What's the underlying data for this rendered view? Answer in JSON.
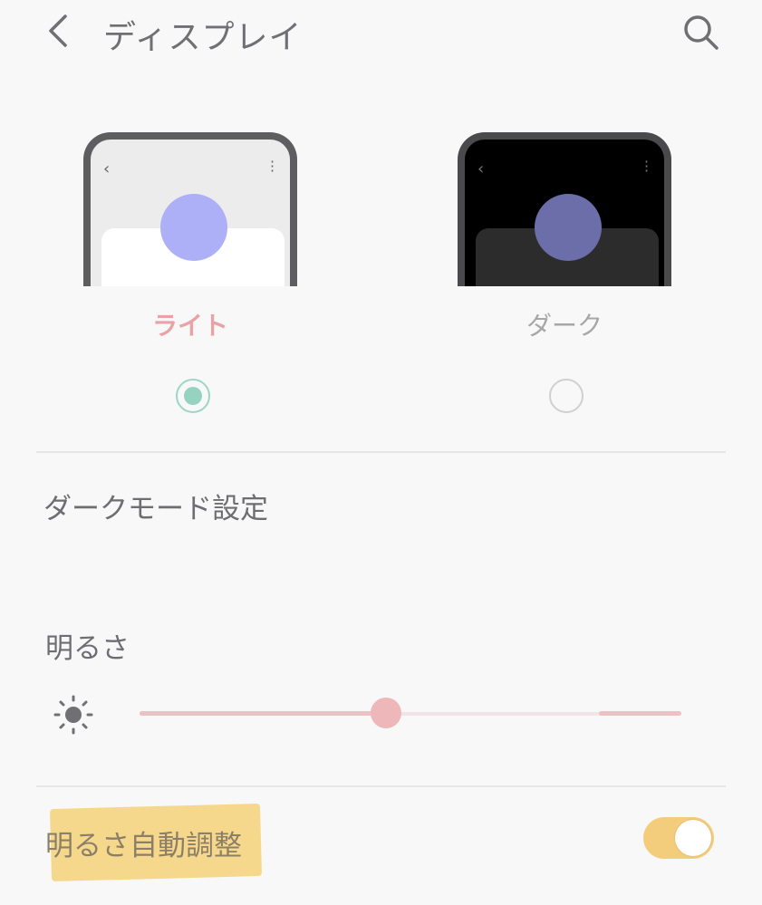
{
  "header": {
    "title": "ディスプレイ"
  },
  "theme": {
    "options": [
      {
        "label": "ライト",
        "selected": true
      },
      {
        "label": "ダーク",
        "selected": false
      }
    ]
  },
  "settings": {
    "dark_mode_settings": "ダークモード設定",
    "brightness": "明るさ",
    "brightness_level_percent": 46,
    "auto_brightness": "明るさ自動調整",
    "auto_brightness_enabled": true
  },
  "icons": {
    "back": "back-icon",
    "search": "search-icon",
    "brightness": "sun-icon"
  },
  "colors": {
    "light_label": "#e9a2a6",
    "radio_selected": "#95d3c0",
    "slider": "#eec0c3",
    "toggle_on": "#f3cd7c",
    "highlight": "#f6d27a"
  }
}
